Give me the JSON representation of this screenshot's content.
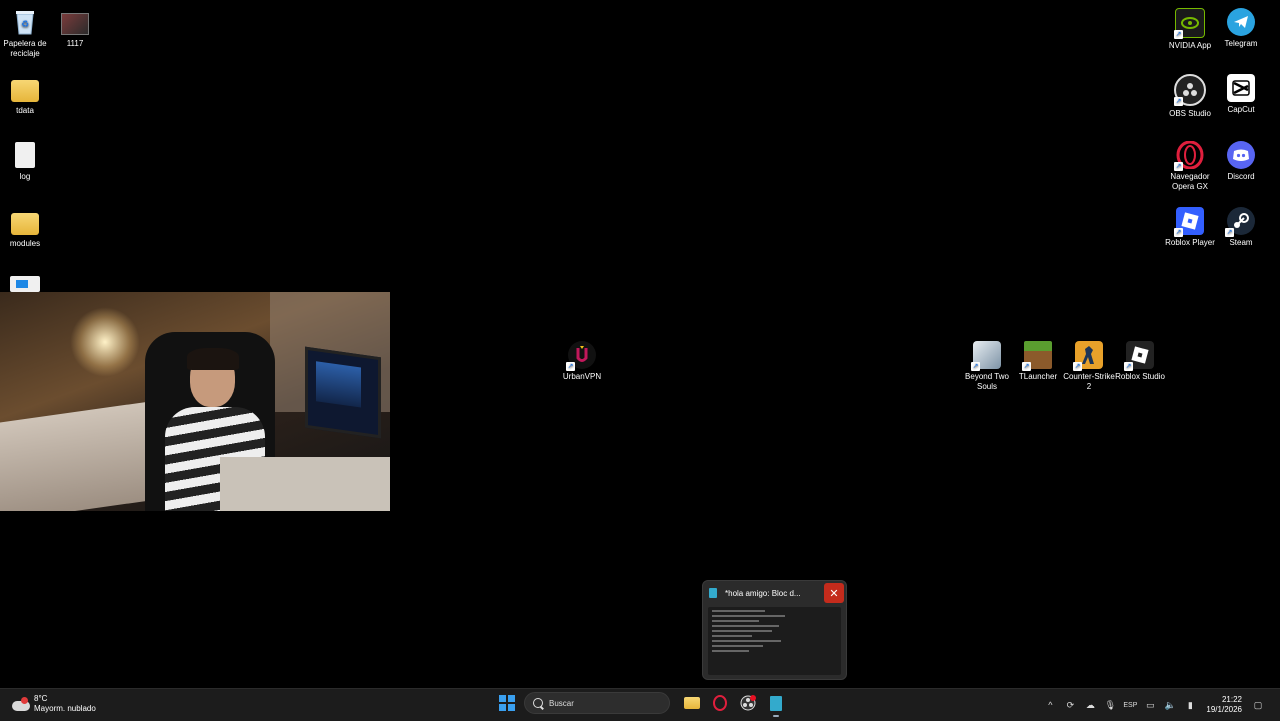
{
  "desktop": {
    "left_icons": [
      {
        "id": "recycle",
        "label": "Papelera de reciclaje",
        "icon": "recycle-bin-icon"
      },
      {
        "id": "video",
        "label": "1117",
        "icon": "video-file-icon"
      },
      {
        "id": "tdata",
        "label": "tdata",
        "icon": "folder-icon"
      },
      {
        "id": "log",
        "label": "log",
        "icon": "text-file-icon"
      },
      {
        "id": "modules",
        "label": "modules",
        "icon": "folder-icon"
      }
    ],
    "right_icons": [
      {
        "id": "nvidia",
        "label": "NVIDIA App",
        "icon": "nvidia-icon",
        "color": "#76b900"
      },
      {
        "id": "telegram",
        "label": "Telegram",
        "icon": "telegram-icon",
        "color": "#2aa3e0"
      },
      {
        "id": "obs",
        "label": "OBS Studio",
        "icon": "obs-icon",
        "color": "#303030"
      },
      {
        "id": "capcut",
        "label": "CapCut",
        "icon": "capcut-icon",
        "color": "#ffffff"
      },
      {
        "id": "opera",
        "label": "Navegador Opera GX",
        "icon": "opera-gx-icon",
        "color": "#e01f3d"
      },
      {
        "id": "discord",
        "label": "Discord",
        "icon": "discord-icon",
        "color": "#5865f2"
      },
      {
        "id": "roblox_player",
        "label": "Roblox Player",
        "icon": "roblox-player-icon",
        "color": "#335fff"
      },
      {
        "id": "steam",
        "label": "Steam",
        "icon": "steam-icon",
        "color": "#1b2838"
      }
    ],
    "middle_icons": [
      {
        "id": "urbanvpn",
        "label": "UrbanVPN",
        "icon": "urbanvpn-icon",
        "color": "#c2185b"
      },
      {
        "id": "beyond",
        "label": "Beyond Two Souls",
        "icon": "beyond-two-souls-icon",
        "color": "#9fb6c8"
      },
      {
        "id": "tlauncher",
        "label": "TLauncher",
        "icon": "tlauncher-icon",
        "color": "#5a9e2f"
      },
      {
        "id": "cs2",
        "label": "Counter-Strike 2",
        "icon": "counter-strike-icon",
        "color": "#e8a12a"
      },
      {
        "id": "roblox_studio",
        "label": "Roblox Studio",
        "icon": "roblox-studio-icon",
        "color": "#222"
      }
    ]
  },
  "preview": {
    "title": "*hola amigo: Bloc d...",
    "close_glyph": "✕"
  },
  "taskbar": {
    "weather_temp": "8°C",
    "weather_desc": "Mayorm. nublado",
    "search_placeholder": "Buscar",
    "lang": "ESP",
    "time": "21:22",
    "date": "19/1/2026"
  }
}
